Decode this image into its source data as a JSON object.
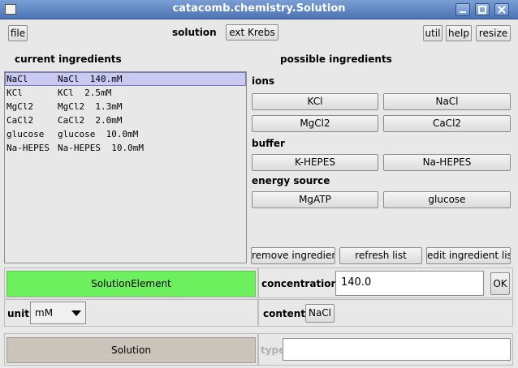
{
  "window": {
    "title": "catacomb.chemistry.Solution"
  },
  "toolbar": {
    "file_label": "file",
    "solution_label": "solution",
    "solution_value": "ext Krebs",
    "util_label": "util",
    "help_label": "help",
    "resize_label": "resize"
  },
  "current": {
    "heading": "current ingredients",
    "items": [
      {
        "name": "NaCl",
        "detail": "NaCl  140.mM"
      },
      {
        "name": "KCl",
        "detail": "KCl  2.5mM"
      },
      {
        "name": "MgCl2",
        "detail": "MgCl2  1.3mM"
      },
      {
        "name": "CaCl2",
        "detail": "CaCl2  2.0mM"
      },
      {
        "name": "glucose",
        "detail": "glucose  10.0mM"
      },
      {
        "name": "Na-HEPES",
        "detail": "Na-HEPES  10.0mM"
      }
    ]
  },
  "possible": {
    "heading": "possible ingredients",
    "ions_label": "ions",
    "ions": [
      "KCl",
      "NaCl",
      "MgCl2",
      "CaCl2"
    ],
    "buffer_label": "buffer",
    "buffer": [
      "K-HEPES",
      "Na-HEPES"
    ],
    "energy_label": "energy source",
    "energy": [
      "MgATP",
      "glucose"
    ],
    "remove_label": "remove ingredient",
    "refresh_label": "refresh list",
    "edit_label": "edit ingredient list"
  },
  "element": {
    "element_button": "SolutionElement",
    "concentration_label": "concentration",
    "concentration_value": "140.0",
    "ok_label": "OK",
    "unit_label": "unit",
    "unit_value": "mM",
    "content_label": "content",
    "content_value": "NaCl",
    "solution_button": "Solution",
    "type_label": "type",
    "type_value": ""
  },
  "colors": {
    "selected_row": "#c9c9f2",
    "element_green": "#6cf05e",
    "solution_grey": "#cbc4bb",
    "titlebar": "#5b82c0"
  }
}
